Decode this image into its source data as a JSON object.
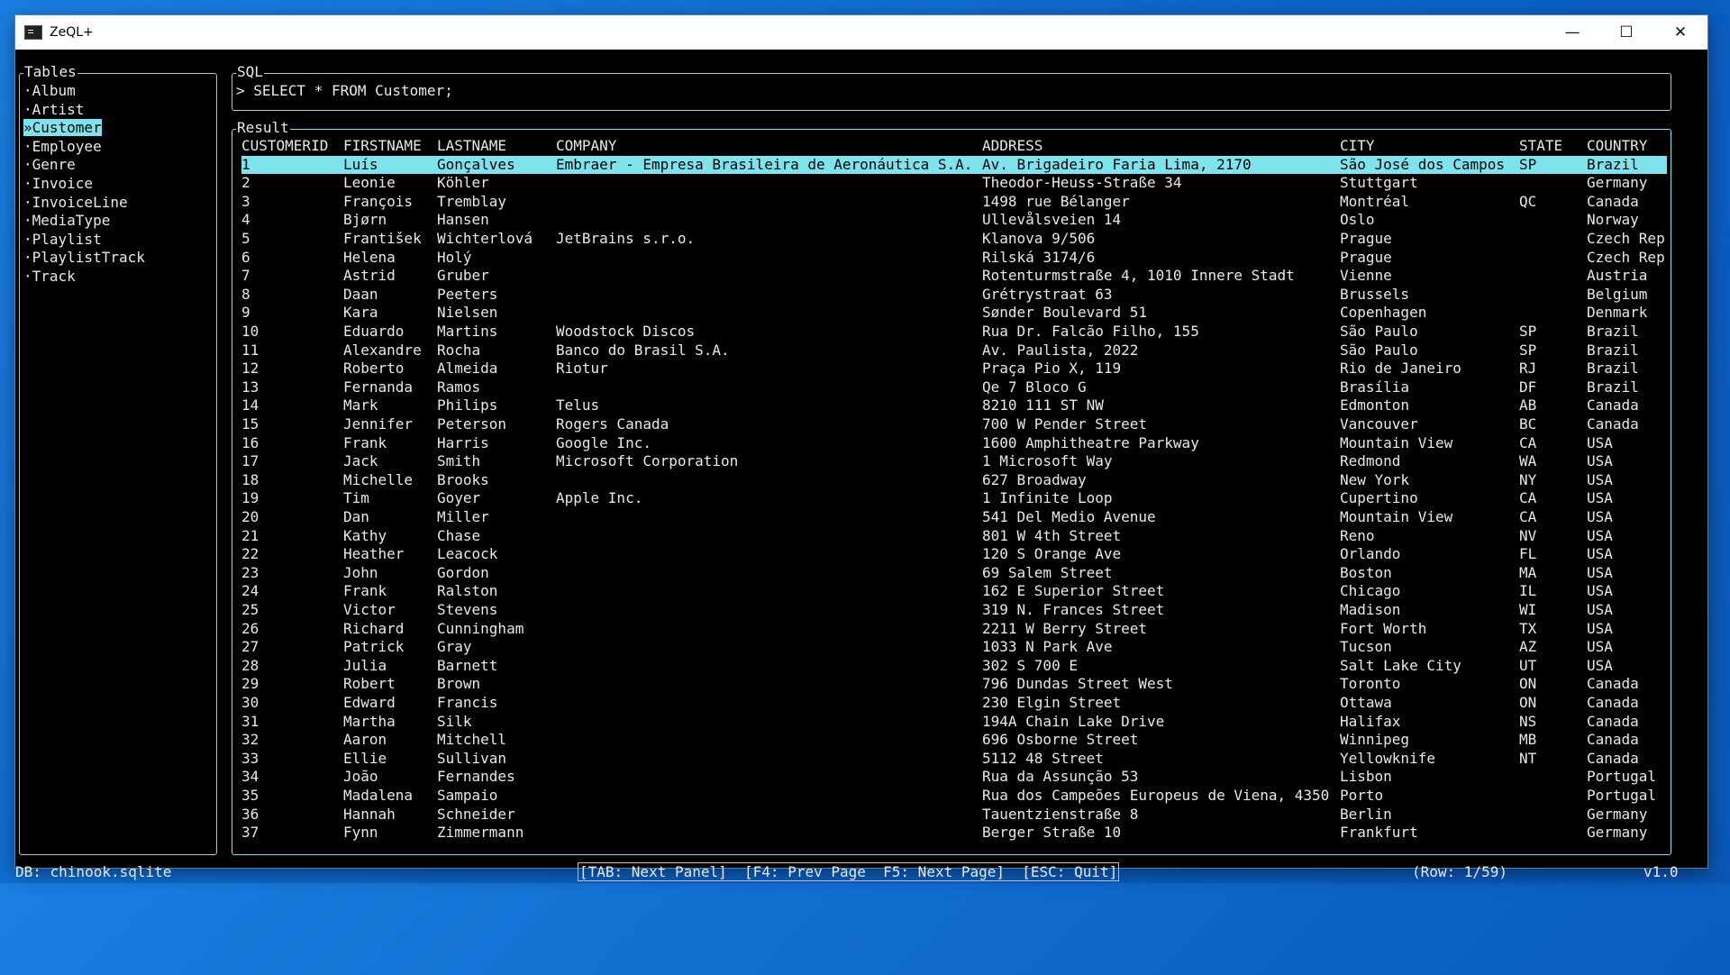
{
  "window": {
    "title": "ZeQL+",
    "minimize": "—",
    "maximize": "☐",
    "close": "✕"
  },
  "tables_panel": {
    "title": "Tables",
    "items": [
      "·Album",
      "·Artist",
      "»Customer",
      "·Employee",
      "·Genre",
      "·Invoice",
      "·InvoiceLine",
      "·MediaType",
      "·Playlist",
      "·PlaylistTrack",
      "·Track"
    ],
    "selected_index": 2
  },
  "sql_panel": {
    "title": "SQL",
    "query": "> SELECT * FROM Customer;"
  },
  "result_panel": {
    "title": "Result",
    "columns": [
      "CUSTOMERID",
      "FIRSTNAME",
      "LASTNAME",
      "COMPANY",
      "ADDRESS",
      "CITY",
      "STATE",
      "COUNTRY"
    ],
    "selected_row": 0,
    "rows": [
      [
        "1",
        "Luís",
        "Gonçalves",
        "Embraer - Empresa Brasileira de Aeronáutica S.A.",
        "Av. Brigadeiro Faria Lima, 2170",
        "São José dos Campos",
        "SP",
        "Brazil"
      ],
      [
        "2",
        "Leonie",
        "Köhler",
        "",
        "Theodor-Heuss-Straße 34",
        "Stuttgart",
        "",
        "Germany"
      ],
      [
        "3",
        "François",
        "Tremblay",
        "",
        "1498 rue Bélanger",
        "Montréal",
        "QC",
        "Canada"
      ],
      [
        "4",
        "Bjørn",
        "Hansen",
        "",
        "Ullevålsveien 14",
        "Oslo",
        "",
        "Norway"
      ],
      [
        "5",
        "František",
        "Wichterlová",
        "JetBrains s.r.o.",
        "Klanova 9/506",
        "Prague",
        "",
        "Czech Rep"
      ],
      [
        "6",
        "Helena",
        "Holý",
        "",
        "Rilská 3174/6",
        "Prague",
        "",
        "Czech Rep"
      ],
      [
        "7",
        "Astrid",
        "Gruber",
        "",
        "Rotenturmstraße 4, 1010 Innere Stadt",
        "Vienne",
        "",
        "Austria"
      ],
      [
        "8",
        "Daan",
        "Peeters",
        "",
        "Grétrystraat 63",
        "Brussels",
        "",
        "Belgium"
      ],
      [
        "9",
        "Kara",
        "Nielsen",
        "",
        "Sønder Boulevard 51",
        "Copenhagen",
        "",
        "Denmark"
      ],
      [
        "10",
        "Eduardo",
        "Martins",
        "Woodstock Discos",
        "Rua Dr. Falcão Filho, 155",
        "São Paulo",
        "SP",
        "Brazil"
      ],
      [
        "11",
        "Alexandre",
        "Rocha",
        "Banco do Brasil S.A.",
        "Av. Paulista, 2022",
        "São Paulo",
        "SP",
        "Brazil"
      ],
      [
        "12",
        "Roberto",
        "Almeida",
        "Riotur",
        "Praça Pio X, 119",
        "Rio de Janeiro",
        "RJ",
        "Brazil"
      ],
      [
        "13",
        "Fernanda",
        "Ramos",
        "",
        "Qe 7 Bloco G",
        "Brasília",
        "DF",
        "Brazil"
      ],
      [
        "14",
        "Mark",
        "Philips",
        "Telus",
        "8210 111 ST NW",
        "Edmonton",
        "AB",
        "Canada"
      ],
      [
        "15",
        "Jennifer",
        "Peterson",
        "Rogers Canada",
        "700 W Pender Street",
        "Vancouver",
        "BC",
        "Canada"
      ],
      [
        "16",
        "Frank",
        "Harris",
        "Google Inc.",
        "1600 Amphitheatre Parkway",
        "Mountain View",
        "CA",
        "USA"
      ],
      [
        "17",
        "Jack",
        "Smith",
        "Microsoft Corporation",
        "1 Microsoft Way",
        "Redmond",
        "WA",
        "USA"
      ],
      [
        "18",
        "Michelle",
        "Brooks",
        "",
        "627 Broadway",
        "New York",
        "NY",
        "USA"
      ],
      [
        "19",
        "Tim",
        "Goyer",
        "Apple Inc.",
        "1 Infinite Loop",
        "Cupertino",
        "CA",
        "USA"
      ],
      [
        "20",
        "Dan",
        "Miller",
        "",
        "541 Del Medio Avenue",
        "Mountain View",
        "CA",
        "USA"
      ],
      [
        "21",
        "Kathy",
        "Chase",
        "",
        "801 W 4th Street",
        "Reno",
        "NV",
        "USA"
      ],
      [
        "22",
        "Heather",
        "Leacock",
        "",
        "120 S Orange Ave",
        "Orlando",
        "FL",
        "USA"
      ],
      [
        "23",
        "John",
        "Gordon",
        "",
        "69 Salem Street",
        "Boston",
        "MA",
        "USA"
      ],
      [
        "24",
        "Frank",
        "Ralston",
        "",
        "162 E Superior Street",
        "Chicago",
        "IL",
        "USA"
      ],
      [
        "25",
        "Victor",
        "Stevens",
        "",
        "319 N. Frances Street",
        "Madison",
        "WI",
        "USA"
      ],
      [
        "26",
        "Richard",
        "Cunningham",
        "",
        "2211 W Berry Street",
        "Fort Worth",
        "TX",
        "USA"
      ],
      [
        "27",
        "Patrick",
        "Gray",
        "",
        "1033 N Park Ave",
        "Tucson",
        "AZ",
        "USA"
      ],
      [
        "28",
        "Julia",
        "Barnett",
        "",
        "302 S 700 E",
        "Salt Lake City",
        "UT",
        "USA"
      ],
      [
        "29",
        "Robert",
        "Brown",
        "",
        "796 Dundas Street West",
        "Toronto",
        "ON",
        "Canada"
      ],
      [
        "30",
        "Edward",
        "Francis",
        "",
        "230 Elgin Street",
        "Ottawa",
        "ON",
        "Canada"
      ],
      [
        "31",
        "Martha",
        "Silk",
        "",
        "194A Chain Lake Drive",
        "Halifax",
        "NS",
        "Canada"
      ],
      [
        "32",
        "Aaron",
        "Mitchell",
        "",
        "696 Osborne Street",
        "Winnipeg",
        "MB",
        "Canada"
      ],
      [
        "33",
        "Ellie",
        "Sullivan",
        "",
        "5112 48 Street",
        "Yellowknife",
        "NT",
        "Canada"
      ],
      [
        "34",
        "João",
        "Fernandes",
        "",
        "Rua da Assunção 53",
        "Lisbon",
        "",
        "Portugal"
      ],
      [
        "35",
        "Madalena",
        "Sampaio",
        "",
        "Rua dos Campeões Europeus de Viena, 4350",
        "Porto",
        "",
        "Portugal"
      ],
      [
        "36",
        "Hannah",
        "Schneider",
        "",
        "Tauentzienstraße 8",
        "Berlin",
        "",
        "Germany"
      ],
      [
        "37",
        "Fynn",
        "Zimmermann",
        "",
        "Berger Straße 10",
        "Frankfurt",
        "",
        "Germany"
      ]
    ]
  },
  "status_bar": {
    "db": "DB: chinook.sqlite",
    "keys": "[TAB: Next Panel]  [F4: Prev Page  F5: Next Page]  [ESC: Quit]",
    "row_info": "(Row: 1/59)",
    "version": "v1.0"
  },
  "colors": {
    "highlight": "#7fe3ee",
    "background": "#000000",
    "text": "#e8e8e8"
  }
}
